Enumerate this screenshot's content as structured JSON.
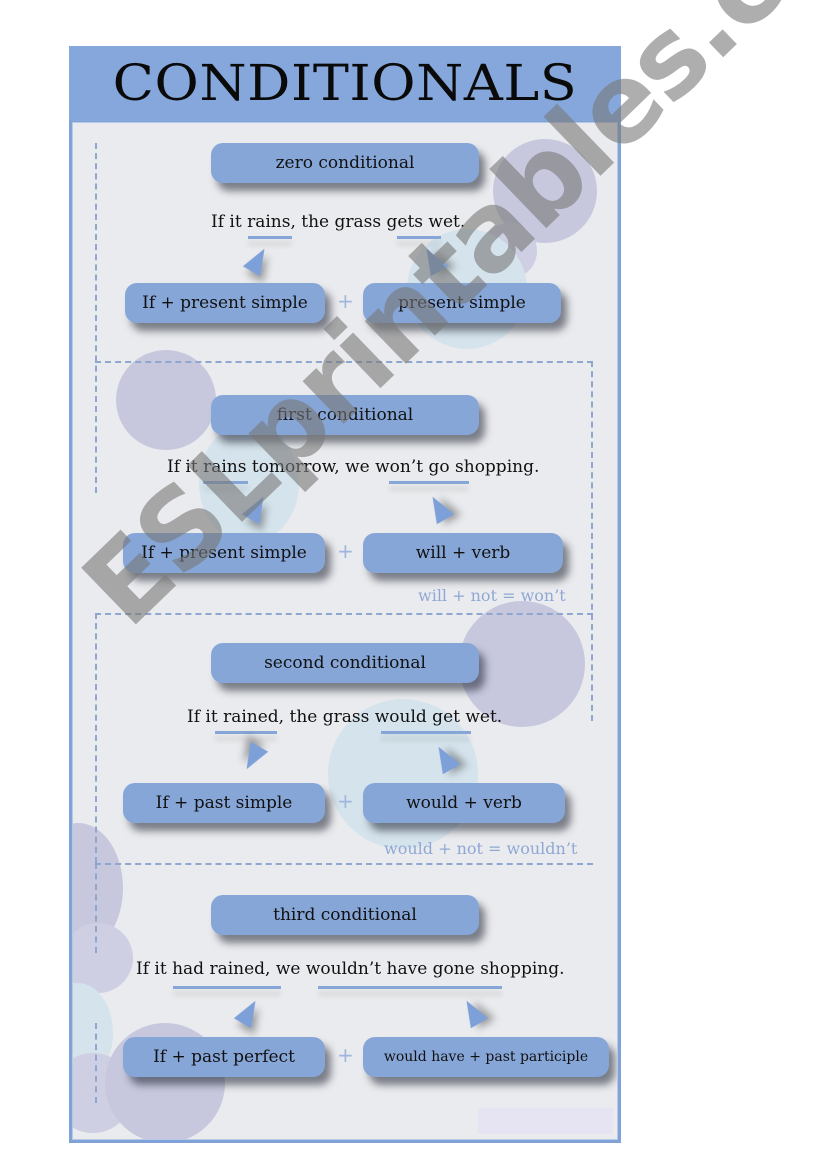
{
  "title": "CONDITIONALS",
  "sections": [
    {
      "name": "zero conditional",
      "example": "If it rains, the grass gets wet.",
      "underlined": [
        "rains",
        "gets"
      ],
      "left_formula": "If + present simple",
      "right_formula": "present simple",
      "note": ""
    },
    {
      "name": "first conditional",
      "example": "If it rains tomorrow, we won’t go shopping.",
      "underlined": [
        "rains",
        "won’t go"
      ],
      "left_formula": "If + present simple",
      "right_formula": "will + verb",
      "note": "will + not = won’t"
    },
    {
      "name": "second conditional",
      "example": "If it rained, the grass would get wet.",
      "underlined": [
        "rained",
        "would get"
      ],
      "left_formula": "If + past simple",
      "right_formula": "would + verb",
      "note": "would + not = wouldn’t"
    },
    {
      "name": "third conditional",
      "example": "If it had rained, we wouldn’t have gone shopping.",
      "underlined": [
        "had rained",
        "wouldn’t have gone"
      ],
      "left_formula": "If + past perfect",
      "right_formula": "would have + past participle",
      "note": ""
    }
  ],
  "plus_sign": "+",
  "watermark": "ESLprintables.com",
  "colors": {
    "header": "#86a7dc",
    "pill": "#86a6d8",
    "panel": "#eaebee",
    "note": "#8fa8d4",
    "watermark": "#8a8a8a"
  }
}
